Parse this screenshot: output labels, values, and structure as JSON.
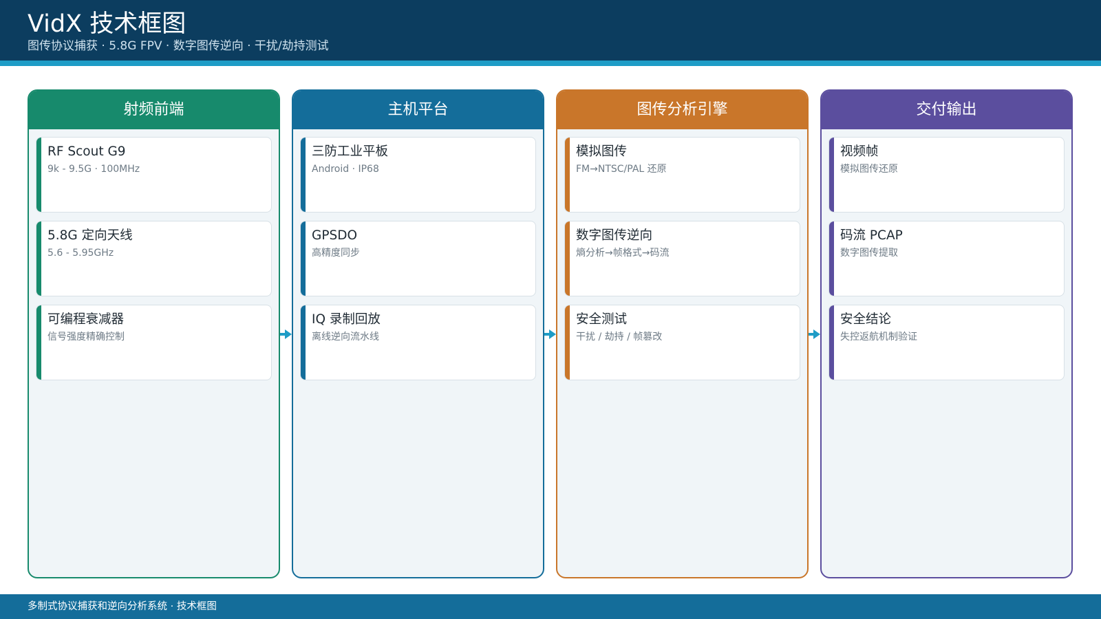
{
  "header": {
    "title": "VidX 技术框图",
    "subtitle": "图传协议捕获 · 5.8G FPV · 数字图传逆向 · 干扰/劫持测试"
  },
  "columns": [
    {
      "title": "射频前端",
      "color": "#178a6c",
      "cards": [
        {
          "title": "RF Scout G9",
          "sub": "9k - 9.5G · 100MHz"
        },
        {
          "title": "5.8G 定向天线",
          "sub": "5.6 - 5.95GHz"
        },
        {
          "title": "可编程衰减器",
          "sub": "信号强度精确控制"
        }
      ]
    },
    {
      "title": "主机平台",
      "color": "#146d9a",
      "cards": [
        {
          "title": "三防工业平板",
          "sub": "Android · IP68"
        },
        {
          "title": "GPSDO",
          "sub": "高精度同步"
        },
        {
          "title": "IQ 录制回放",
          "sub": "离线逆向流水线"
        }
      ]
    },
    {
      "title": "图传分析引擎",
      "color": "#c9762a",
      "cards": [
        {
          "title": "模拟图传",
          "sub": "FM→NTSC/PAL 还原"
        },
        {
          "title": "数字图传逆向",
          "sub": "熵分析→帧格式→码流"
        },
        {
          "title": "安全测试",
          "sub": "干扰 / 劫持 / 帧篡改"
        }
      ]
    },
    {
      "title": "交付输出",
      "color": "#5b4e9e",
      "cards": [
        {
          "title": "视频帧",
          "sub": "模拟图传还原"
        },
        {
          "title": "码流 PCAP",
          "sub": "数字图传提取"
        },
        {
          "title": "安全结论",
          "sub": "失控返航机制验证"
        }
      ]
    }
  ],
  "arrow_color": "#1e9cc6",
  "footer": {
    "text": "多制式协议捕获和逆向分析系统 · 技术框图"
  }
}
